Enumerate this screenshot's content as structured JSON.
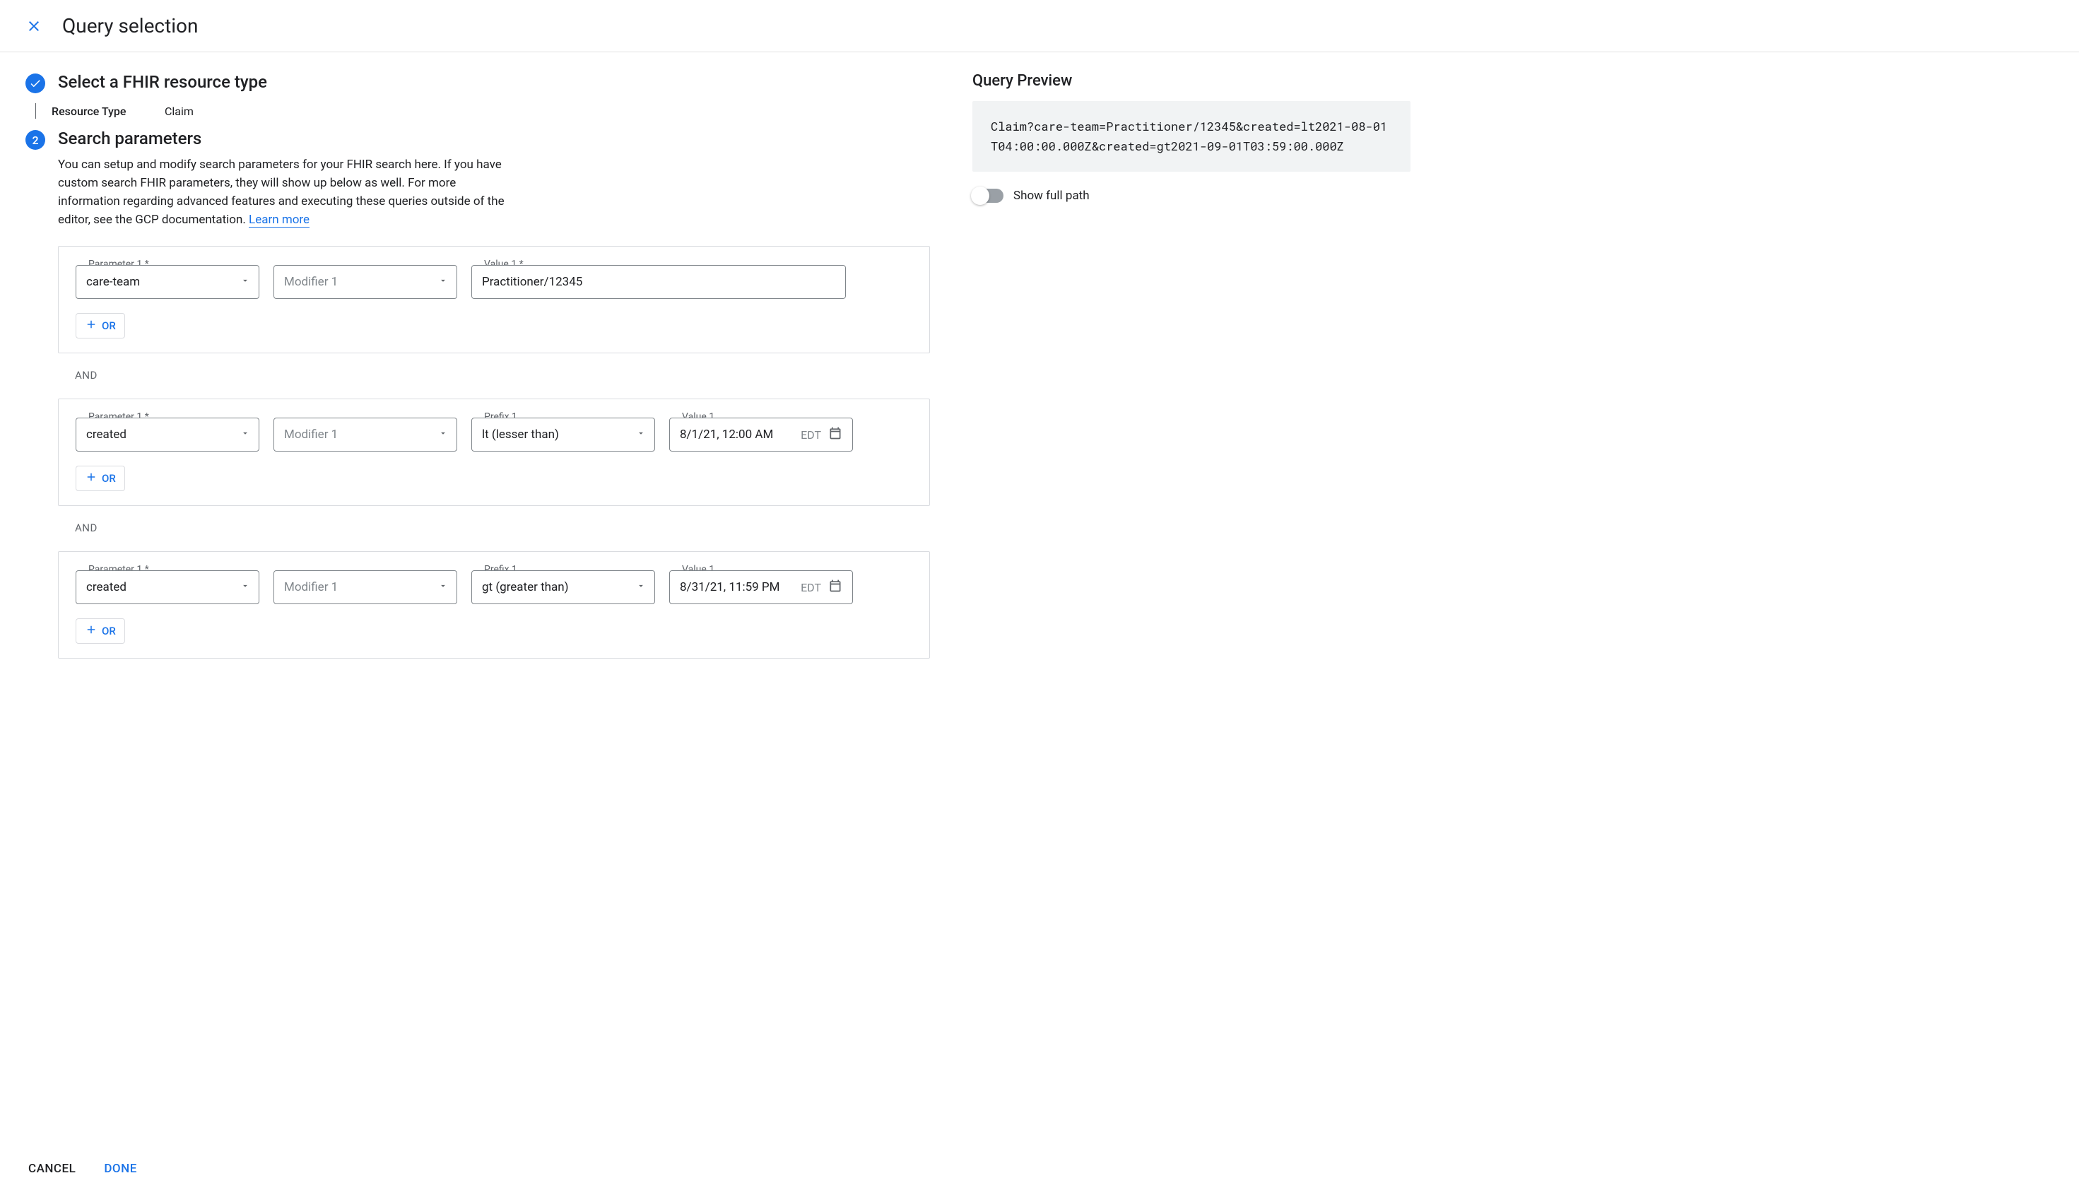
{
  "header": {
    "title": "Query selection"
  },
  "step1": {
    "title": "Select a FHIR resource type",
    "resource_type_label": "Resource Type",
    "resource_type_value": "Claim"
  },
  "step2": {
    "badge": "2",
    "title": "Search parameters",
    "description_pre": "You can setup and modify search parameters for your FHIR search here. If you have custom search FHIR parameters, they will show up below as well. For more information regarding advanced features and executing these queries outside of the editor, see the GCP documentation. ",
    "learn_more": "Learn more"
  },
  "groups": [
    {
      "param_label": "Parameter 1 *",
      "param_value": "care-team",
      "modifier_label": "Modifier 1",
      "modifier_value": "",
      "prefix_label": "",
      "prefix_value": "",
      "value_label": "Value 1 *",
      "value_text": "Practitioner/12345",
      "value_tz": "",
      "show_prefix": false,
      "value_is_date": false
    },
    {
      "param_label": "Parameter 1 *",
      "param_value": "created",
      "modifier_label": "Modifier 1",
      "modifier_value": "",
      "prefix_label": "Prefix 1",
      "prefix_value": "lt (lesser than)",
      "value_label": "Value 1",
      "value_text": "8/1/21, 12:00 AM",
      "value_tz": "EDT",
      "show_prefix": true,
      "value_is_date": true
    },
    {
      "param_label": "Parameter 1 *",
      "param_value": "created",
      "modifier_label": "Modifier 1",
      "modifier_value": "",
      "prefix_label": "Prefix 1",
      "prefix_value": "gt (greater than)",
      "value_label": "Value 1",
      "value_text": "8/31/21, 11:59 PM",
      "value_tz": "EDT",
      "show_prefix": true,
      "value_is_date": true
    }
  ],
  "or_label": "OR",
  "and_label": "AND",
  "preview": {
    "title": "Query Preview",
    "text": "Claim?care-team=Practitioner/12345&created=lt2021-08-01T04:00:00.000Z&created=gt2021-09-01T03:59:00.000Z",
    "toggle_label": "Show full path"
  },
  "footer": {
    "cancel": "CANCEL",
    "done": "DONE"
  }
}
